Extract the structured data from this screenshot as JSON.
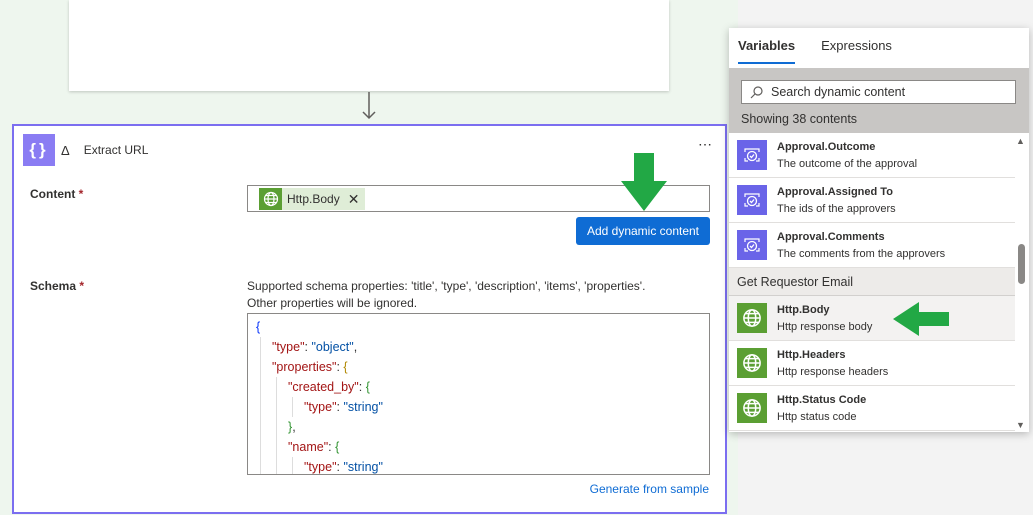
{
  "action": {
    "title": "Extract URL",
    "more": "⋯",
    "content_label": "Content",
    "schema_label": "Schema",
    "required_mark": "*",
    "token_label": "Http.Body",
    "token_remove": "✕",
    "add_dynamic_label": "Add dynamic content",
    "schema_desc_line1": "Supported schema properties: 'title', 'type', 'description', 'items', 'properties'.",
    "schema_desc_line2": "Other properties will be ignored.",
    "generate_label": "Generate from sample",
    "code_lines": [
      {
        "indent": 0,
        "tokens": [
          [
            "{",
            "b1"
          ]
        ]
      },
      {
        "indent": 1,
        "tokens": [
          [
            "\"type\"",
            "k"
          ],
          [
            ": ",
            "p"
          ],
          [
            "\"object\"",
            "s"
          ],
          [
            ",",
            "p"
          ]
        ]
      },
      {
        "indent": 1,
        "tokens": [
          [
            "\"properties\"",
            "k"
          ],
          [
            ": ",
            "p"
          ],
          [
            "{",
            "b2"
          ]
        ]
      },
      {
        "indent": 2,
        "tokens": [
          [
            "\"created_by\"",
            "k"
          ],
          [
            ": ",
            "p"
          ],
          [
            "{",
            "b3"
          ]
        ]
      },
      {
        "indent": 3,
        "tokens": [
          [
            "\"type\"",
            "k"
          ],
          [
            ": ",
            "p"
          ],
          [
            "\"string\"",
            "s"
          ]
        ]
      },
      {
        "indent": 2,
        "tokens": [
          [
            "}",
            "b3"
          ],
          [
            ",",
            "p"
          ]
        ]
      },
      {
        "indent": 2,
        "tokens": [
          [
            "\"name\"",
            "k"
          ],
          [
            ": ",
            "p"
          ],
          [
            "{",
            "b3"
          ]
        ]
      },
      {
        "indent": 3,
        "tokens": [
          [
            "\"type\"",
            "k"
          ],
          [
            ": ",
            "p"
          ],
          [
            "\"string\"",
            "s"
          ]
        ]
      }
    ]
  },
  "panel": {
    "tabs": [
      {
        "label": "Variables",
        "active": true
      },
      {
        "label": "Expressions",
        "active": false
      }
    ],
    "search_placeholder": "Search dynamic content",
    "count_text": "Showing 38 contents",
    "items_approval": [
      {
        "name": "Approval.Outcome",
        "desc": "The outcome of the approval",
        "icon": "approval-icon"
      },
      {
        "name": "Approval.Assigned To",
        "desc": "The ids of the approvers",
        "icon": "approval-icon"
      },
      {
        "name": "Approval.Comments",
        "desc": "The comments from the approvers",
        "icon": "approval-icon"
      }
    ],
    "group_label": "Get Requestor Email",
    "items_http": [
      {
        "name": "Http.Body",
        "desc": "Http response body",
        "icon": "globe-icon"
      },
      {
        "name": "Http.Headers",
        "desc": "Http response headers",
        "icon": "globe-icon"
      },
      {
        "name": "Http.Status Code",
        "desc": "Http status code",
        "icon": "globe-icon"
      }
    ]
  },
  "colors": {
    "accent": "#0f6cd4",
    "action_border": "#7b6ef0",
    "approval": "#6a64e8",
    "http": "#5b9f33",
    "annotation_arrow": "#22a845"
  }
}
